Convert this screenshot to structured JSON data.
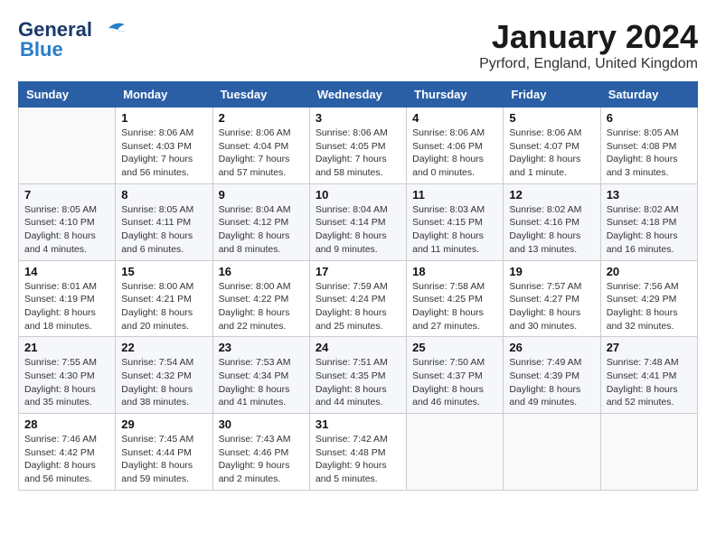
{
  "header": {
    "logo_general": "General",
    "logo_blue": "Blue",
    "title": "January 2024",
    "subtitle": "Pyrford, England, United Kingdom"
  },
  "weekdays": [
    "Sunday",
    "Monday",
    "Tuesday",
    "Wednesday",
    "Thursday",
    "Friday",
    "Saturday"
  ],
  "weeks": [
    [
      {
        "day": "",
        "info": ""
      },
      {
        "day": "1",
        "info": "Sunrise: 8:06 AM\nSunset: 4:03 PM\nDaylight: 7 hours\nand 56 minutes."
      },
      {
        "day": "2",
        "info": "Sunrise: 8:06 AM\nSunset: 4:04 PM\nDaylight: 7 hours\nand 57 minutes."
      },
      {
        "day": "3",
        "info": "Sunrise: 8:06 AM\nSunset: 4:05 PM\nDaylight: 7 hours\nand 58 minutes."
      },
      {
        "day": "4",
        "info": "Sunrise: 8:06 AM\nSunset: 4:06 PM\nDaylight: 8 hours\nand 0 minutes."
      },
      {
        "day": "5",
        "info": "Sunrise: 8:06 AM\nSunset: 4:07 PM\nDaylight: 8 hours\nand 1 minute."
      },
      {
        "day": "6",
        "info": "Sunrise: 8:05 AM\nSunset: 4:08 PM\nDaylight: 8 hours\nand 3 minutes."
      }
    ],
    [
      {
        "day": "7",
        "info": "Sunrise: 8:05 AM\nSunset: 4:10 PM\nDaylight: 8 hours\nand 4 minutes."
      },
      {
        "day": "8",
        "info": "Sunrise: 8:05 AM\nSunset: 4:11 PM\nDaylight: 8 hours\nand 6 minutes."
      },
      {
        "day": "9",
        "info": "Sunrise: 8:04 AM\nSunset: 4:12 PM\nDaylight: 8 hours\nand 8 minutes."
      },
      {
        "day": "10",
        "info": "Sunrise: 8:04 AM\nSunset: 4:14 PM\nDaylight: 8 hours\nand 9 minutes."
      },
      {
        "day": "11",
        "info": "Sunrise: 8:03 AM\nSunset: 4:15 PM\nDaylight: 8 hours\nand 11 minutes."
      },
      {
        "day": "12",
        "info": "Sunrise: 8:02 AM\nSunset: 4:16 PM\nDaylight: 8 hours\nand 13 minutes."
      },
      {
        "day": "13",
        "info": "Sunrise: 8:02 AM\nSunset: 4:18 PM\nDaylight: 8 hours\nand 16 minutes."
      }
    ],
    [
      {
        "day": "14",
        "info": "Sunrise: 8:01 AM\nSunset: 4:19 PM\nDaylight: 8 hours\nand 18 minutes."
      },
      {
        "day": "15",
        "info": "Sunrise: 8:00 AM\nSunset: 4:21 PM\nDaylight: 8 hours\nand 20 minutes."
      },
      {
        "day": "16",
        "info": "Sunrise: 8:00 AM\nSunset: 4:22 PM\nDaylight: 8 hours\nand 22 minutes."
      },
      {
        "day": "17",
        "info": "Sunrise: 7:59 AM\nSunset: 4:24 PM\nDaylight: 8 hours\nand 25 minutes."
      },
      {
        "day": "18",
        "info": "Sunrise: 7:58 AM\nSunset: 4:25 PM\nDaylight: 8 hours\nand 27 minutes."
      },
      {
        "day": "19",
        "info": "Sunrise: 7:57 AM\nSunset: 4:27 PM\nDaylight: 8 hours\nand 30 minutes."
      },
      {
        "day": "20",
        "info": "Sunrise: 7:56 AM\nSunset: 4:29 PM\nDaylight: 8 hours\nand 32 minutes."
      }
    ],
    [
      {
        "day": "21",
        "info": "Sunrise: 7:55 AM\nSunset: 4:30 PM\nDaylight: 8 hours\nand 35 minutes."
      },
      {
        "day": "22",
        "info": "Sunrise: 7:54 AM\nSunset: 4:32 PM\nDaylight: 8 hours\nand 38 minutes."
      },
      {
        "day": "23",
        "info": "Sunrise: 7:53 AM\nSunset: 4:34 PM\nDaylight: 8 hours\nand 41 minutes."
      },
      {
        "day": "24",
        "info": "Sunrise: 7:51 AM\nSunset: 4:35 PM\nDaylight: 8 hours\nand 44 minutes."
      },
      {
        "day": "25",
        "info": "Sunrise: 7:50 AM\nSunset: 4:37 PM\nDaylight: 8 hours\nand 46 minutes."
      },
      {
        "day": "26",
        "info": "Sunrise: 7:49 AM\nSunset: 4:39 PM\nDaylight: 8 hours\nand 49 minutes."
      },
      {
        "day": "27",
        "info": "Sunrise: 7:48 AM\nSunset: 4:41 PM\nDaylight: 8 hours\nand 52 minutes."
      }
    ],
    [
      {
        "day": "28",
        "info": "Sunrise: 7:46 AM\nSunset: 4:42 PM\nDaylight: 8 hours\nand 56 minutes."
      },
      {
        "day": "29",
        "info": "Sunrise: 7:45 AM\nSunset: 4:44 PM\nDaylight: 8 hours\nand 59 minutes."
      },
      {
        "day": "30",
        "info": "Sunrise: 7:43 AM\nSunset: 4:46 PM\nDaylight: 9 hours\nand 2 minutes."
      },
      {
        "day": "31",
        "info": "Sunrise: 7:42 AM\nSunset: 4:48 PM\nDaylight: 9 hours\nand 5 minutes."
      },
      {
        "day": "",
        "info": ""
      },
      {
        "day": "",
        "info": ""
      },
      {
        "day": "",
        "info": ""
      }
    ]
  ]
}
